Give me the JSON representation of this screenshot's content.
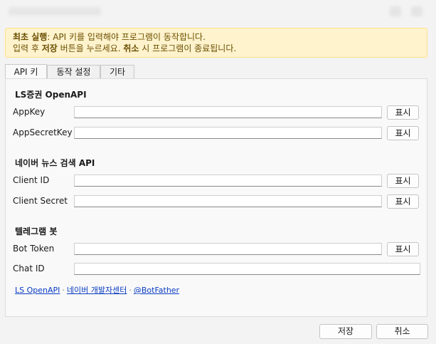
{
  "banner": {
    "line1_bold": "최초 실행",
    "line1_rest": ": API 키를 입력해야 프로그램이 동작합니다.",
    "line2_pre": "입력 후 ",
    "line2_save": "저장",
    "line2_mid": " 버튼을 누르세요. ",
    "line2_cancel": "취소",
    "line2_post": " 시 프로그램이 종료됩니다."
  },
  "tabs": [
    {
      "label": "API 키",
      "active": true
    },
    {
      "label": "동작 설정",
      "active": false
    },
    {
      "label": "기타",
      "active": false
    }
  ],
  "sections": {
    "ls": {
      "title": "LS증권 OpenAPI",
      "appkey_label": "AppKey",
      "appsecret_label": "AppSecretKey"
    },
    "naver": {
      "title": "네이버 뉴스 검색 API",
      "client_id_label": "Client ID",
      "client_secret_label": "Client Secret"
    },
    "telegram": {
      "title": "텔레그램 봇",
      "bot_token_label": "Bot Token",
      "chat_id_label": "Chat ID"
    }
  },
  "show_label": "표시",
  "links": {
    "ls": "LS OpenAPI",
    "sep": "·",
    "naver": "네이버 개발자센터",
    "botfather": "@BotFather"
  },
  "footer": {
    "save": "저장",
    "cancel": "취소"
  },
  "colors": {
    "banner_bg": "#fff3cd",
    "banner_border": "#ffe08a",
    "link": "#0a3cc2"
  }
}
